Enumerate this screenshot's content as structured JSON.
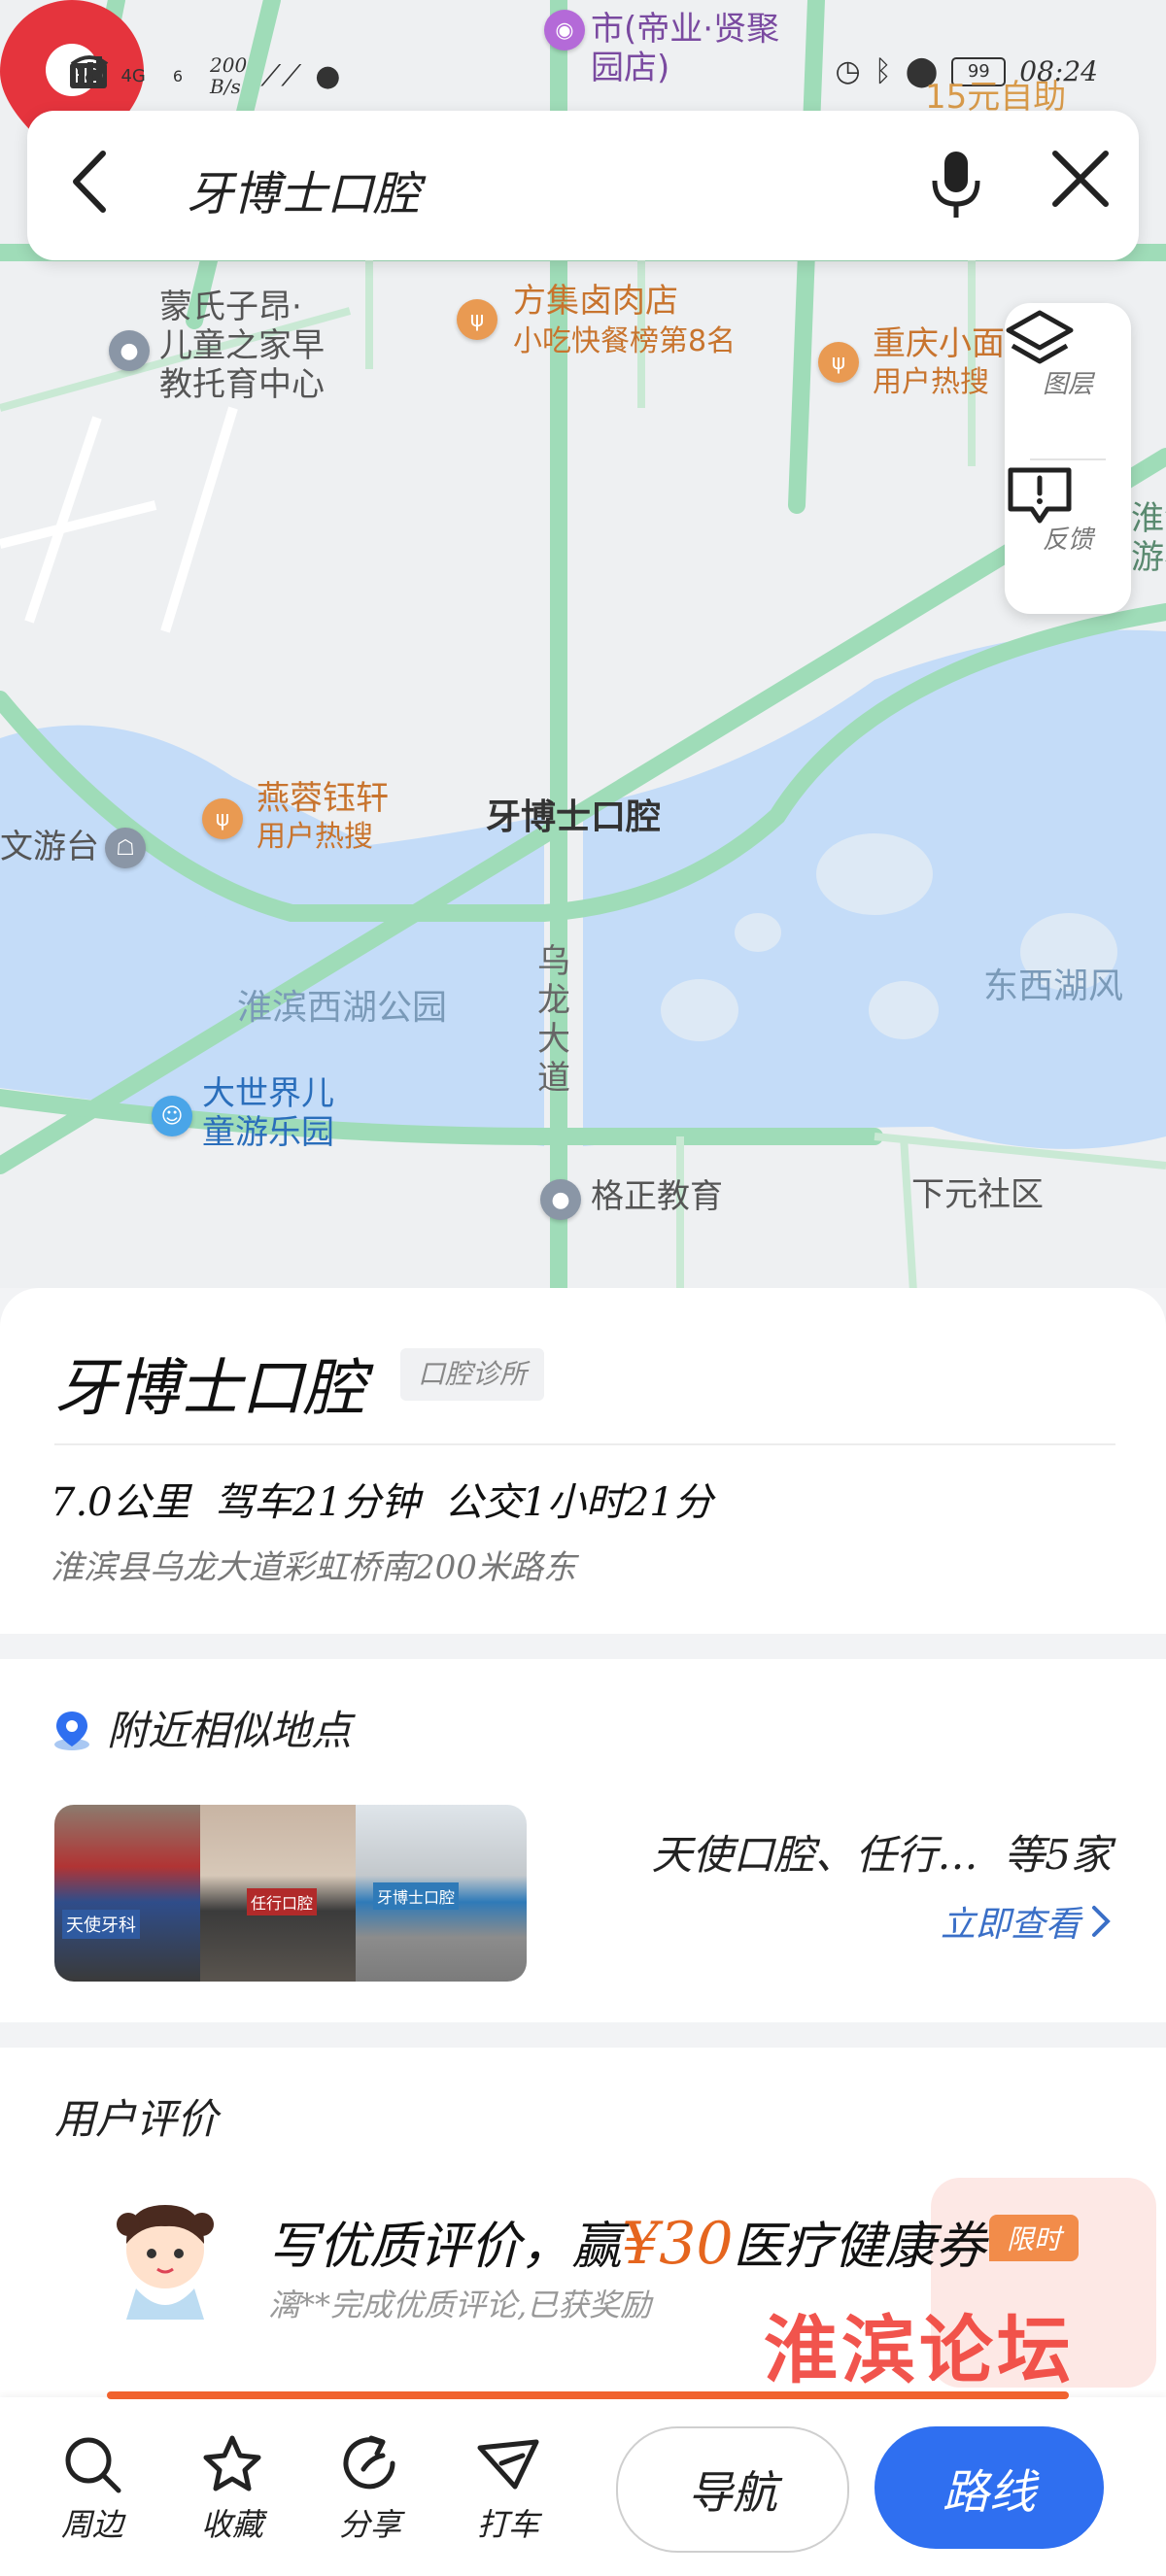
{
  "status_bar": {
    "left_badges": [
      "HD",
      "4G",
      "6"
    ],
    "net_speed_value": "200",
    "net_speed_unit": "B/s",
    "time": "08:24",
    "battery": "99"
  },
  "promo_text": "15元自助",
  "search": {
    "query": "牙博士口腔",
    "back_icon": "back-arrow-icon",
    "mic_icon": "microphone-icon",
    "close_icon": "close-icon"
  },
  "map_controls": {
    "layers_label": "图层",
    "feedback_label": "反馈"
  },
  "map": {
    "selected_label": "牙博士口腔",
    "labels": {
      "top_poi": "市(帝业·贤聚\n园店)",
      "kindergarten": "蒙氏子昂·\n儿童之家早\n教托育中心",
      "restaurant1": "方集卤肉店",
      "restaurant1_sub": "小吃快餐榜第8名",
      "restaurant2": "重庆小面",
      "restaurant2_sub": "用户热搜",
      "right_edge": "淮滨\n游客",
      "restaurant3": "燕蓉钰轩",
      "restaurant3_sub": "用户热搜",
      "tour_desk": "文游台",
      "park": "淮滨西湖公园",
      "road": "乌龙大道",
      "east_lake": "东西湖风",
      "playground": "大世界儿\n童游乐园",
      "education": "格正教育",
      "community": "下元社区"
    }
  },
  "place": {
    "name": "牙博士口腔",
    "category": "口腔诊所",
    "distance": "7.0公里",
    "drive": "驾车21分钟",
    "transit": "公交1小时21分",
    "address": "淮滨县乌龙大道彩虹桥南200米路东"
  },
  "similar": {
    "title": "附近相似地点",
    "summary": "天使口腔、任行…",
    "count": "等5家",
    "link": "立即查看",
    "photo_signs": [
      "天使牙科",
      "任行口腔",
      "牙博士口腔"
    ]
  },
  "reviews": {
    "title": "用户评价",
    "promo_prefix": "写优质评价，赢",
    "promo_amount": "¥30",
    "promo_suffix": "医疗健康券",
    "tag": "限时",
    "sub": "漓**完成优质评论,已获奖励",
    "watermark": "淮滨论坛"
  },
  "bottom_bar": {
    "nearby": "周边",
    "favorite": "收藏",
    "share": "分享",
    "taxi": "打车",
    "navigate": "导航",
    "route": "路线"
  },
  "colors": {
    "primary_blue": "#2f6ff0",
    "road_green": "#9fdcb8",
    "water": "#c4dcf8",
    "pin_red": "#e5343d",
    "accent_orange": "#e5651e"
  }
}
